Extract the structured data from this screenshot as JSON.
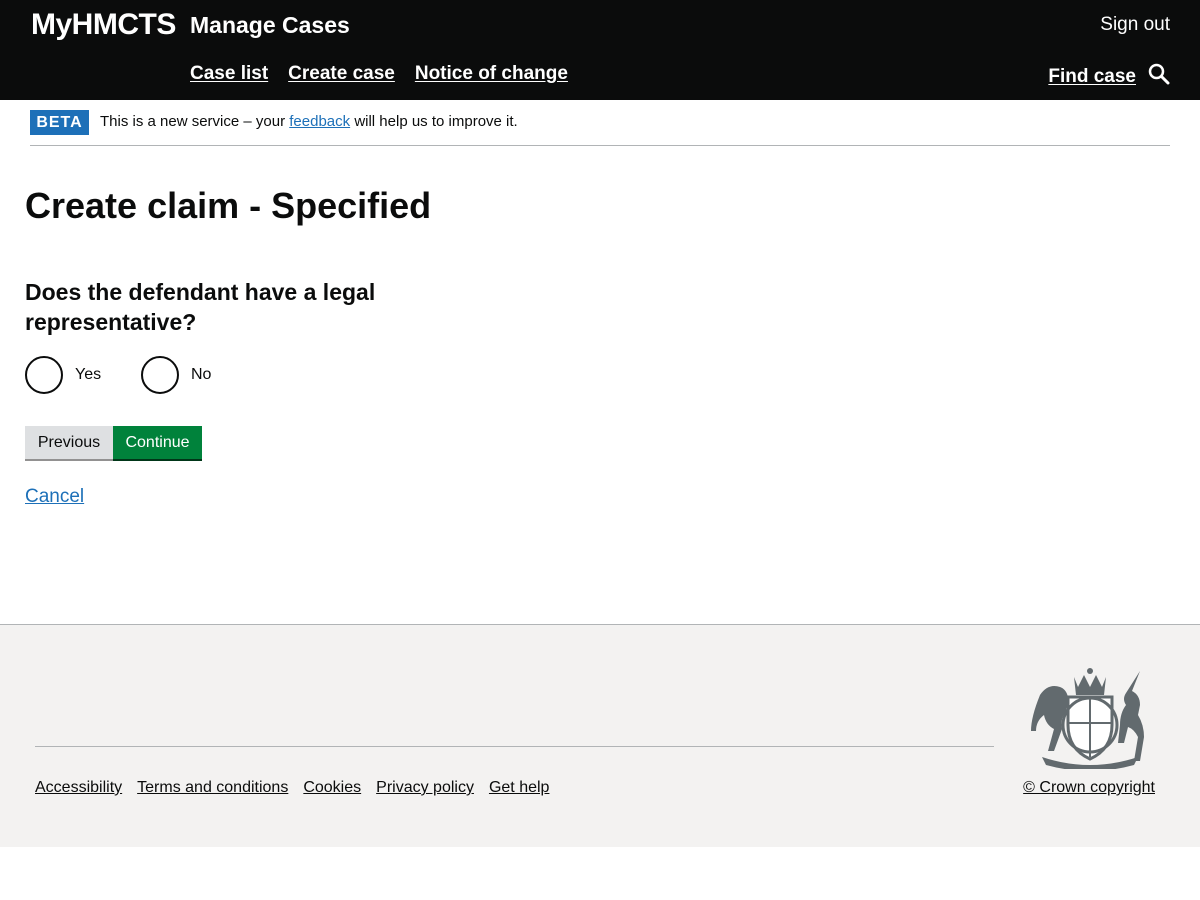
{
  "header": {
    "brand": "MyHMCTS",
    "service": "Manage Cases",
    "sign_out": "Sign out",
    "nav": [
      "Case list",
      "Create case",
      "Notice of change"
    ],
    "find_case": "Find case"
  },
  "beta": {
    "tag": "BETA",
    "text_before": "This is a new service – your",
    "link": "feedback",
    "text_after": "will help us to improve it."
  },
  "page": {
    "title": "Create claim - Specified",
    "question": "Does the defendant have a legal representative?",
    "options": [
      "Yes",
      "No"
    ],
    "previous": "Previous",
    "continue": "Continue",
    "cancel": "Cancel"
  },
  "footer": {
    "links": [
      "Accessibility",
      "Terms and conditions",
      "Cookies",
      "Privacy policy",
      "Get help"
    ],
    "copyright": "© Crown copyright"
  },
  "colors": {
    "header_bg": "#0b0c0c",
    "link": "#1d70b8",
    "continue_bg": "#00823b",
    "beta_tag": "#1d70b8",
    "footer_bg": "#f3f2f1"
  },
  "icons": {
    "search": "search-icon",
    "crest": "royal-coat-of-arms-icon"
  }
}
